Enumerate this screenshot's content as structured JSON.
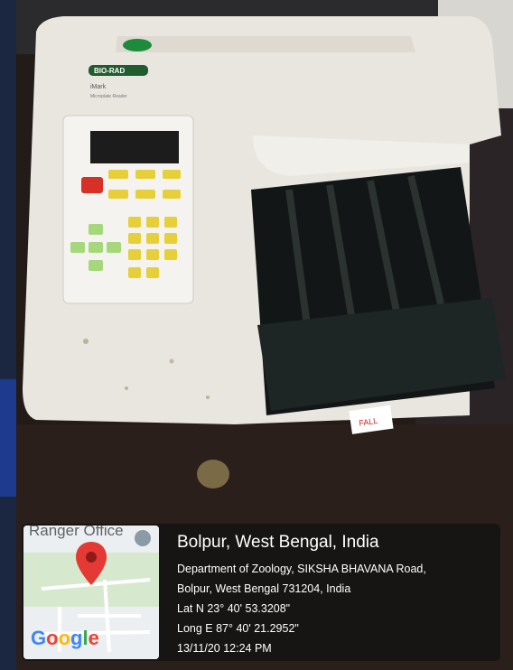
{
  "photo": {
    "device_brand": "BIO-RAD",
    "device_model": "iMark",
    "device_subtitle": "Microplate Reader",
    "tube_label": "FALL"
  },
  "geotag": {
    "map_label": "Ranger Office",
    "map_brand": "Google",
    "location_title": "Bolpur, West Bengal, India",
    "address_line1": "Department of Zoology, SIKSHA BHAVANA Road,",
    "address_line2": "Bolpur, West Bengal 731204, India",
    "latitude": "Lat N 23° 40' 53.3208\"",
    "longitude": "Long E 87° 40' 21.2952\"",
    "timestamp": "13/11/20 12:24 PM",
    "pin_color": "#e53935",
    "card_background": "#141414"
  }
}
